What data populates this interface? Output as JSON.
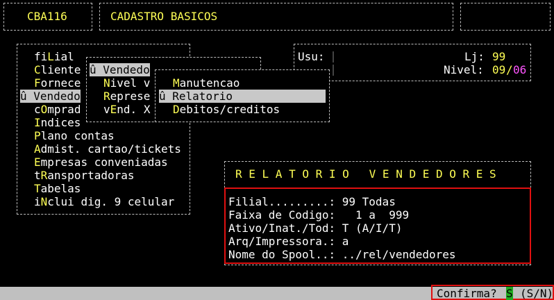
{
  "header": {
    "program_code": "CBA116",
    "screen_title": "CADASTRO BASICOS"
  },
  "main_menu": {
    "items": [
      {
        "hotkey": "",
        "pre": "fi",
        "key": "L",
        "post": "ial"
      },
      {
        "hotkey": "C",
        "pre": "",
        "key": "",
        "post": "liente"
      },
      {
        "hotkey": "F",
        "pre": "",
        "key": "",
        "post": "ornece"
      },
      {
        "hotkey": "",
        "pre": "û Vendedo",
        "key": "",
        "post": ""
      },
      {
        "hotkey": "",
        "pre": "c",
        "key": "O",
        "post": "mprad"
      },
      {
        "hotkey": "I",
        "pre": "",
        "key": "",
        "post": "ndices"
      },
      {
        "hotkey": "P",
        "pre": "",
        "key": "",
        "post": "lano contas"
      },
      {
        "hotkey": "A",
        "pre": "",
        "key": "",
        "post": "dmist. cartao/tickets"
      },
      {
        "hotkey": "E",
        "pre": "",
        "key": "",
        "post": "mpresas conveniadas"
      },
      {
        "hotkey": "",
        "pre": "t",
        "key": "R",
        "post": "ansportadoras"
      },
      {
        "hotkey": "T",
        "pre": "",
        "key": "",
        "post": "abelas"
      },
      {
        "hotkey": "",
        "pre": "i",
        "key": "N",
        "post": "clui dig. 9 celular"
      }
    ]
  },
  "submenu_vendedor": {
    "title": "û Vendedo",
    "items": [
      {
        "key": "N",
        "rest": "ivel v"
      },
      {
        "key": "R",
        "rest": "eprese"
      },
      {
        "pre": "v",
        "key": "E",
        "rest": "nd. X"
      }
    ]
  },
  "submenu_report": {
    "items": [
      {
        "prefix": "",
        "key": "M",
        "rest": "anutencao"
      },
      {
        "prefix": "û ",
        "key": "R",
        "rest": "elatorio"
      },
      {
        "prefix": "",
        "key": "D",
        "rest": "ebitos/creditos"
      }
    ]
  },
  "user_panel": {
    "usu_label": "Usu:",
    "lj_label": "Lj:",
    "lj_value": "99",
    "nivel_label": "Nivel:",
    "nivel_value": "09",
    "nivel_sep": "/",
    "nivel_max": "06"
  },
  "report_dialog": {
    "title": "R E L A T O R I O   V E N D E D O R E S",
    "fields": [
      {
        "label": "Filial.........:",
        "value": " 99 Todas"
      },
      {
        "label": "Faixa de Codigo:",
        "value": "   1 a  999"
      },
      {
        "label": "Ativo/Inat./Tod:",
        "value": " T (A/I/T)"
      },
      {
        "label": "Arq/Impressora.:",
        "value": " a"
      },
      {
        "label": "Nome do Spool..:",
        "value": " ../rel/vendedores"
      }
    ]
  },
  "status_bar": {
    "prompt": "Confirma?",
    "answer": "S",
    "options": "(S/N)"
  },
  "colors": {
    "background": "#000000",
    "highlight_text": "#ffff55",
    "magenta": "#ff55ff",
    "selection_bg": "#c8c8c8",
    "status_bar_bg": "#c0c0c0",
    "answer_bg": "#22aa22",
    "error_frame": "#e01010"
  }
}
